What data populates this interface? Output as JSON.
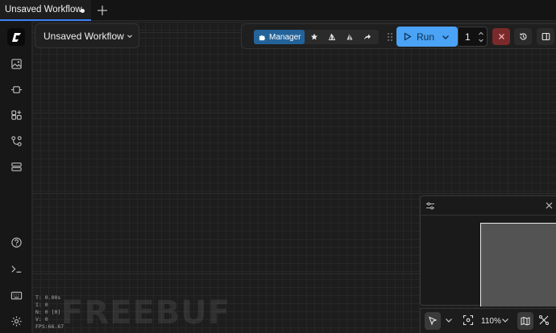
{
  "tabs": [
    {
      "title": "Unsaved Workflow",
      "modified": true
    }
  ],
  "workflow": {
    "title": "Unsaved Workflow"
  },
  "toolbar": {
    "manager_label": "Manager",
    "run_label": "Run",
    "batch_count": "1"
  },
  "sidebar": {
    "items": [
      "images-icon",
      "node-library-icon",
      "model-library-icon",
      "workflows-icon",
      "templates-icon"
    ],
    "bottom": [
      "help-icon",
      "terminal-icon",
      "keyboard-icon",
      "settings-icon"
    ]
  },
  "canvas_controls": {
    "zoom": "110%"
  },
  "stats": {
    "time": "T: 0.00s",
    "index": "I: 0",
    "nodes": "N: 0 [0]",
    "version": "V: 0",
    "fps": "FPS:66.67"
  },
  "watermark": "FREEBUF",
  "colors": {
    "accent": "#4aa3f5",
    "manager": "#23639a",
    "cancel": "#7a2a2a"
  }
}
